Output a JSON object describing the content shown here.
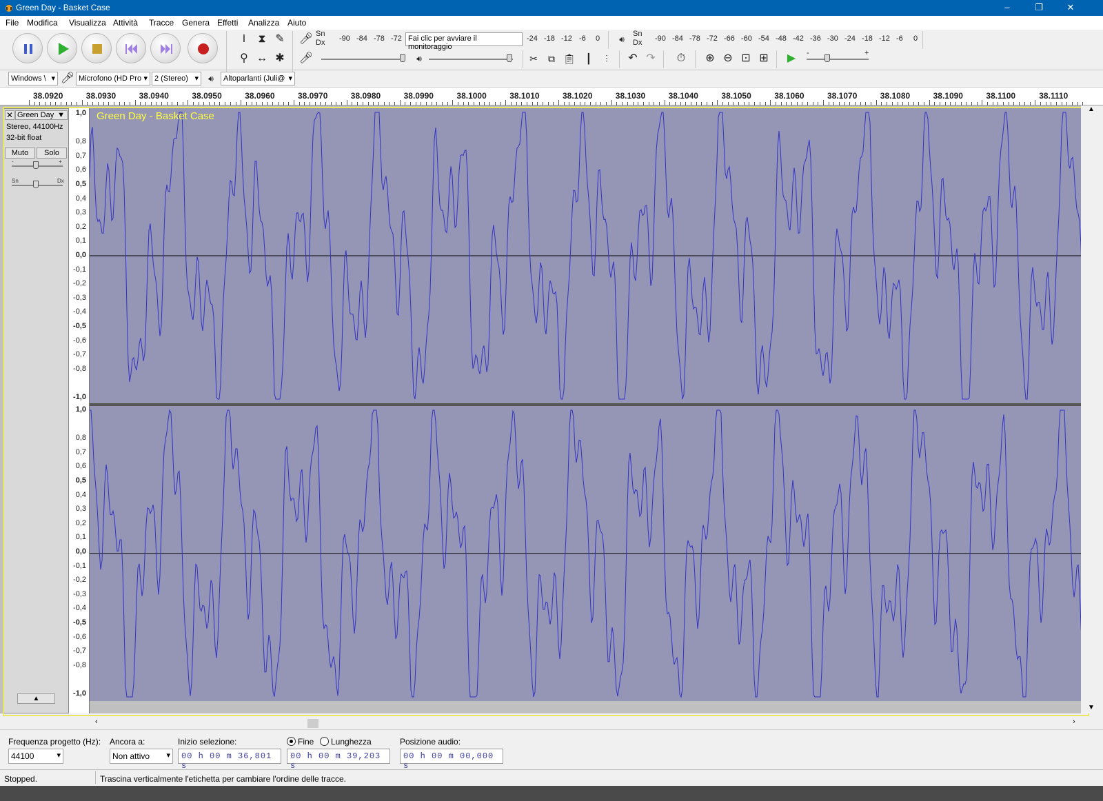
{
  "window": {
    "title": "Green Day - Basket Case",
    "minimize": "–",
    "maximize": "❐",
    "close": "✕"
  },
  "menu": [
    "File",
    "Modifica",
    "Visualizza",
    "Attività",
    "Tracce",
    "Genera",
    "Effetti",
    "Analizza",
    "Aiuto"
  ],
  "transport": {
    "buttons": [
      "pause",
      "play",
      "stop",
      "skip-start",
      "skip-end",
      "record"
    ]
  },
  "meters": {
    "rec_lr": "Sn\nDx",
    "play_lr": "Sn\nDx",
    "rec_scale_left": [
      "-90",
      "-84",
      "-78",
      "-72"
    ],
    "rec_monitor_text": "Fai clic per avviare il monitoraggio",
    "rec_scale_right": [
      "-24",
      "-18",
      "-12",
      "-6",
      "0"
    ],
    "play_scale": [
      "-90",
      "-84",
      "-78",
      "-72",
      "-66",
      "-60",
      "-54",
      "-48",
      "-42",
      "-36",
      "-30",
      "-24",
      "-18",
      "-12",
      "-6",
      "0"
    ]
  },
  "devices": {
    "host": "Windows \\",
    "mic": "Microfono (HD Pro",
    "channels": "2 (Stereo)",
    "speakers": "Altoparlanti (Juli@"
  },
  "ruler": [
    "38.0920",
    "38.0930",
    "38.0940",
    "38.0950",
    "38.0960",
    "38.0970",
    "38.0980",
    "38.0990",
    "38.1000",
    "38.1010",
    "38.1020",
    "38.1030",
    "38.1040",
    "38.1050",
    "38.1060",
    "38.1070",
    "38.1080",
    "38.1090",
    "38.1100",
    "38.1110"
  ],
  "track": {
    "name": "Green Day",
    "label": "Green Day - Basket Case",
    "format": "Stereo, 44100Hz",
    "bits": "32-bit float",
    "mute": "Muto",
    "solo": "Solo",
    "gain_minus": "-",
    "gain_plus": "+",
    "pan_left": "Sn",
    "pan_right": "Dx",
    "close": "✕",
    "collapse": "▲"
  },
  "vruler": [
    "1,0",
    "0,8",
    "0,7",
    "0,6",
    "0,5",
    "0,4",
    "0,3",
    "0,2",
    "0,1",
    "0,0",
    "-0,1",
    "-0,2",
    "-0,3",
    "-0,4",
    "-0,5",
    "-0,6",
    "-0,7",
    "-0,8",
    "-1,0"
  ],
  "colors": {
    "wave_bg": "#9595b5",
    "wave_line": "#3232c8",
    "title_bar": "#0063b1",
    "track_label": "#ffff40"
  },
  "selection": {
    "rate_label": "Frequenza progetto (Hz):",
    "rate_value": "44100",
    "snap_label": "Ancora a:",
    "snap_value": "Non attivo",
    "start_label": "Inizio selezione:",
    "start_value": "00 h 00 m 36,801 s",
    "end_radio": "Fine",
    "length_radio": "Lunghezza",
    "end_value": "00 h 00 m 39,203 s",
    "pos_label": "Posizione audio:",
    "pos_value": "00 h 00 m 00,000 s"
  },
  "status": {
    "left": "Stopped.",
    "right": "Trascina verticalmente l'etichetta per cambiare l'ordine delle tracce."
  }
}
